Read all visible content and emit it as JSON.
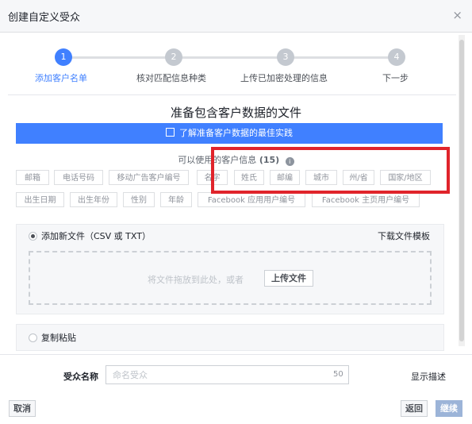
{
  "dialog": {
    "title": "创建自定义受众",
    "close_label": "×"
  },
  "steps": [
    {
      "number": "1",
      "label": "添加客户名单",
      "active": true
    },
    {
      "number": "2",
      "label": "核对匹配信息种类",
      "active": false
    },
    {
      "number": "3",
      "label": "上传已加密处理的信息",
      "active": false
    },
    {
      "number": "4",
      "label": "下一步",
      "active": false
    }
  ],
  "prepare": {
    "title": "准备包含客户数据的文件",
    "banner_text": "了解准备客户数据的最佳实践",
    "available_label": "可以使用的客户信息",
    "available_count": "(15)"
  },
  "tags_row1": [
    "邮箱",
    "电话号码",
    "移动广告客户编号",
    "名字",
    "姓氏",
    "邮编",
    "城市",
    "州/省",
    "国家/地区"
  ],
  "tags_row2": [
    "出生日期",
    "出生年份",
    "性别",
    "年龄",
    "Facebook 应用用户编号",
    "Facebook 主页用户编号"
  ],
  "upload": {
    "option_label": "添加新文件（CSV 或 TXT）",
    "download_link": "下载文件模板",
    "drop_text": "将文件拖放到此处，或者",
    "upload_button": "上传文件"
  },
  "paste": {
    "option_label": "复制粘贴"
  },
  "audience": {
    "name_label": "受众名称",
    "name_placeholder": "命名受众",
    "name_value": "",
    "char_limit": "50",
    "show_description": "显示描述"
  },
  "footer": {
    "cancel": "取消",
    "back": "返回",
    "continue": "继续"
  },
  "colors": {
    "accent": "#4080ff",
    "highlight_box": "#e0242b"
  }
}
